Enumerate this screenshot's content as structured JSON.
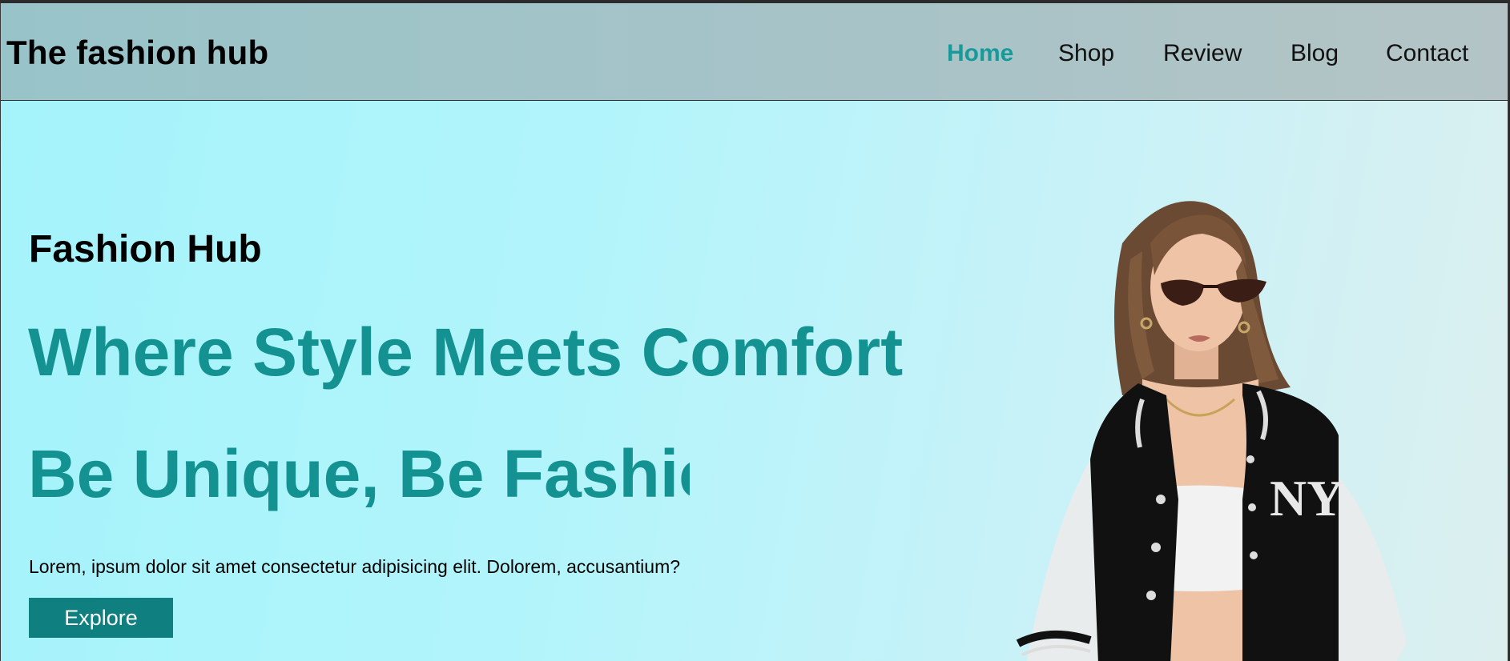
{
  "header": {
    "brand": "The fashion hub",
    "nav": [
      {
        "label": "Home",
        "active": true
      },
      {
        "label": "Shop",
        "active": false
      },
      {
        "label": "Review",
        "active": false
      },
      {
        "label": "Blog",
        "active": false
      },
      {
        "label": "Contact",
        "active": false
      }
    ]
  },
  "hero": {
    "kicker": "Fashion Hub",
    "headline_1": "Where Style Meets Comfort",
    "headline_2": "Be Unique, Be Fashionable",
    "description": "Lorem, ipsum dolor sit amet consectetur adipisicing elit. Dolorem, accusantium?",
    "cta_label": "Explore",
    "image_logo": "NY"
  },
  "colors": {
    "accent": "#149291",
    "button": "#0f7f7f",
    "nav_active": "#189a9a"
  }
}
